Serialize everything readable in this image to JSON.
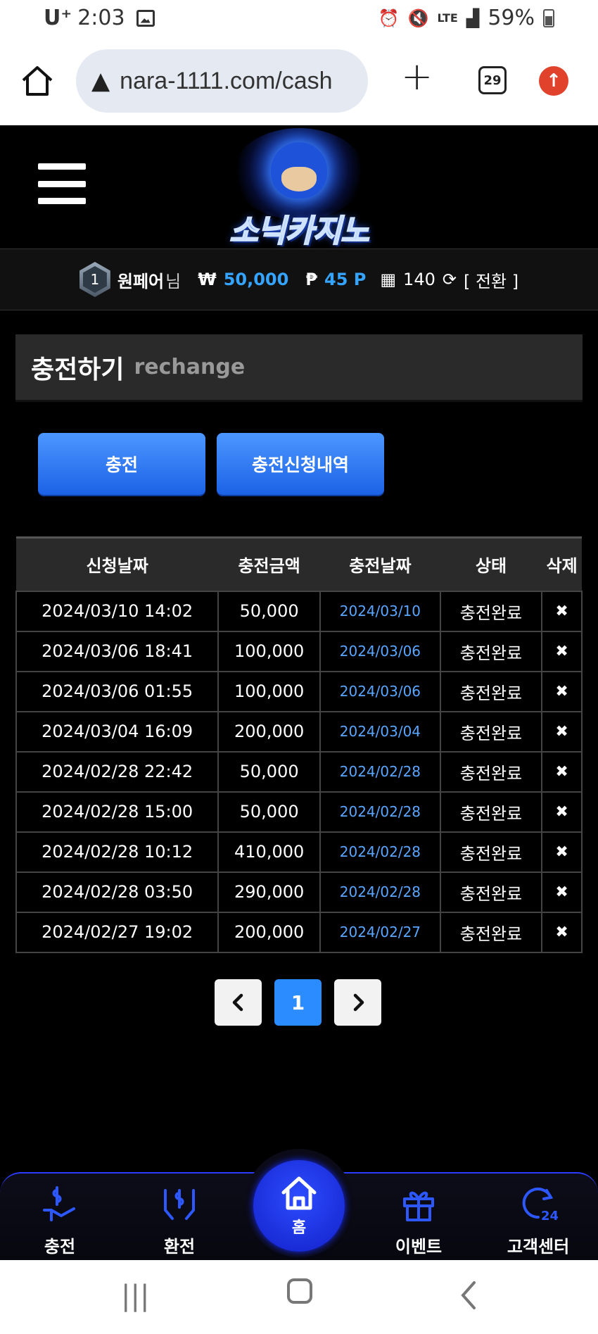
{
  "status_bar": {
    "carrier": "U⁺",
    "time": "2:03",
    "network": "LTE",
    "battery": "59%"
  },
  "browser": {
    "url": "nara-1111.com/cash",
    "tab_count": "29"
  },
  "header": {
    "logo_text": "소닉카지노"
  },
  "user": {
    "level": "1",
    "name": "원페어",
    "suffix": "님",
    "currency_symbol": "₩",
    "money": "50,000",
    "point_symbol": "₱",
    "points": "45 P",
    "chips": "140",
    "convert_label": "[ 전환 ]"
  },
  "section": {
    "title": "충전하기",
    "subtitle": "rechange"
  },
  "actions": {
    "charge": "충전",
    "history": "충전신청내역"
  },
  "table": {
    "headers": [
      "신청날짜",
      "충전금액",
      "충전날짜",
      "상태",
      "삭제"
    ],
    "rows": [
      {
        "request_date": "2024/03/10 14:02",
        "amount": "50,000",
        "charge_date": "2024/03/10",
        "status": "충전완료",
        "delete": "✖"
      },
      {
        "request_date": "2024/03/06 18:41",
        "amount": "100,000",
        "charge_date": "2024/03/06",
        "status": "충전완료",
        "delete": "✖"
      },
      {
        "request_date": "2024/03/06 01:55",
        "amount": "100,000",
        "charge_date": "2024/03/06",
        "status": "충전완료",
        "delete": "✖"
      },
      {
        "request_date": "2024/03/04 16:09",
        "amount": "200,000",
        "charge_date": "2024/03/04",
        "status": "충전완료",
        "delete": "✖"
      },
      {
        "request_date": "2024/02/28 22:42",
        "amount": "50,000",
        "charge_date": "2024/02/28",
        "status": "충전완료",
        "delete": "✖"
      },
      {
        "request_date": "2024/02/28 15:00",
        "amount": "50,000",
        "charge_date": "2024/02/28",
        "status": "충전완료",
        "delete": "✖"
      },
      {
        "request_date": "2024/02/28 10:12",
        "amount": "410,000",
        "charge_date": "2024/02/28",
        "status": "충전완료",
        "delete": "✖"
      },
      {
        "request_date": "2024/02/28 03:50",
        "amount": "290,000",
        "charge_date": "2024/02/28",
        "status": "충전완료",
        "delete": "✖"
      },
      {
        "request_date": "2024/02/27 19:02",
        "amount": "200,000",
        "charge_date": "2024/02/27",
        "status": "충전완료",
        "delete": "✖"
      }
    ]
  },
  "pagination": {
    "current": "1"
  },
  "bottom_nav": {
    "charge": "충전",
    "exchange": "환전",
    "home": "홈",
    "event": "이벤트",
    "support": "고객센터"
  },
  "colors": {
    "accent": "#2a8cff",
    "money": "#35a4ff",
    "nav_icon": "#2d57ff"
  }
}
